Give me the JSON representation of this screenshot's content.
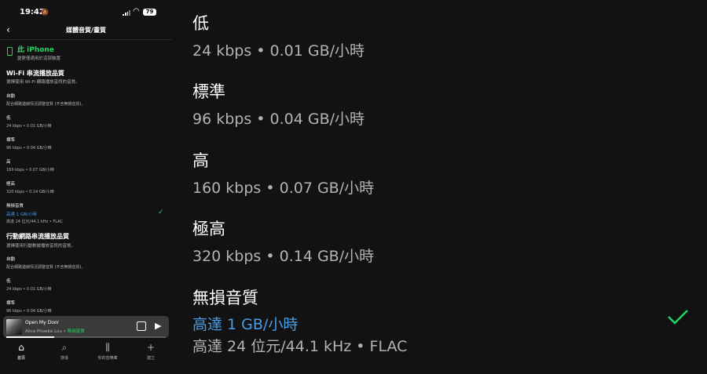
{
  "status": {
    "time": "19:42",
    "battery": "79"
  },
  "header": {
    "title": "媒體音質/畫質"
  },
  "device": {
    "name": "此 iPhone",
    "subtitle": "變更僅適用於這部裝置"
  },
  "wifi": {
    "title": "Wi-Fi 串流播放品質",
    "subtitle": "選擇使用 Wi-Fi 網路播放音訊的音質。",
    "options": [
      {
        "label": "自動",
        "desc": "配合網路連線情況調整音質 (不含無損音質)。"
      },
      {
        "label": "低",
        "desc": "24 kbps • 0.01 GB/小時"
      },
      {
        "label": "標準",
        "desc": "96 kbps • 0.04 GB/小時"
      },
      {
        "label": "高",
        "desc": "160 kbps • 0.07 GB/小時"
      },
      {
        "label": "極高",
        "desc": "320 kbps • 0.14 GB/小時"
      },
      {
        "label": "無損音質",
        "desc_highlight": "高達 1 GB/小時",
        "desc": "高達 24 位元/44.1 kHz • FLAC",
        "selected": true
      }
    ]
  },
  "cellular": {
    "title": "行動網路串流播放品質",
    "subtitle": "選擇使用行動數據播放音訊的音質。",
    "options": [
      {
        "label": "自動",
        "desc": "配合網路連線情況調整音質 (不含無損音質)。"
      },
      {
        "label": "低",
        "desc": "24 kbps • 0.01 GB/小時"
      },
      {
        "label": "標準",
        "desc": "96 kbps • 0.04 GB/小時"
      }
    ]
  },
  "player": {
    "song": "Open My Door",
    "artist": "Alice Phoebe Lou • ",
    "quality_badge": "無損音質",
    "progress": 0.3
  },
  "tabs": [
    {
      "label": "首頁",
      "icon": "home-icon",
      "active": true
    },
    {
      "label": "搜尋",
      "icon": "search-icon",
      "active": false
    },
    {
      "label": "你的音樂庫",
      "icon": "library-icon",
      "active": false
    },
    {
      "label": "建立",
      "icon": "plus-icon",
      "active": false
    }
  ],
  "colors": {
    "accent": "#1ed760",
    "highlight": "#4b9ce8",
    "background": "#121212"
  }
}
